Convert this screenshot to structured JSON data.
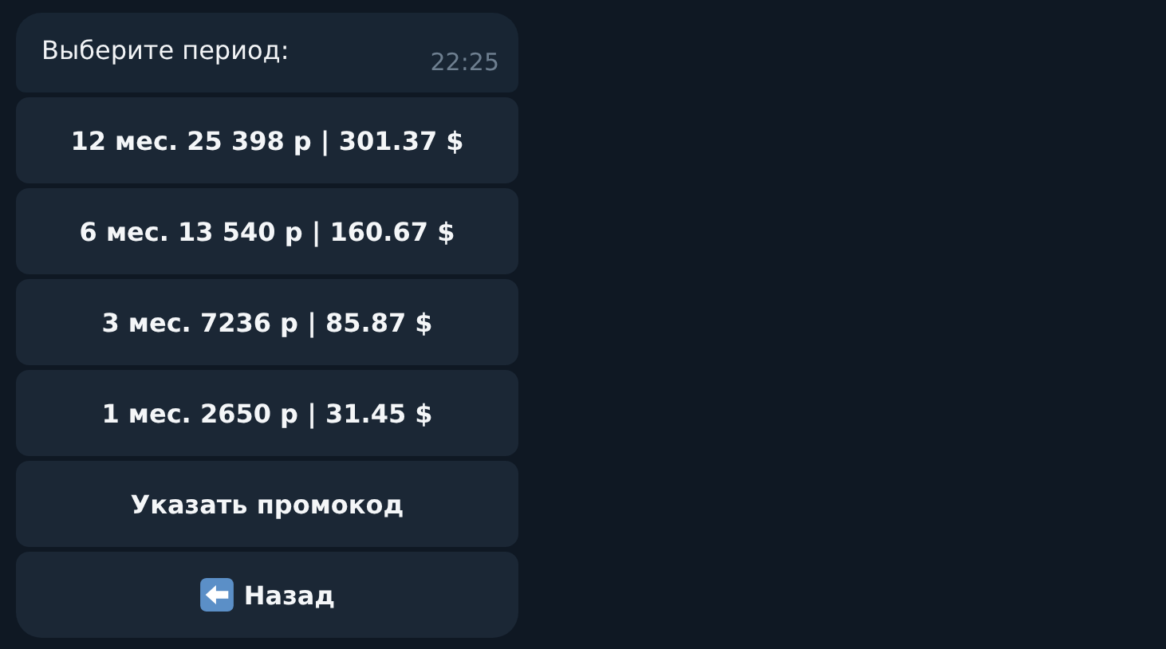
{
  "message": {
    "text": "Выберите период:",
    "time": "22:25"
  },
  "buttons": [
    {
      "kind": "text",
      "label": "12 мес. 25 398 р | 301.37 $"
    },
    {
      "kind": "text",
      "label": "6 мес. 13 540 р | 160.67 $"
    },
    {
      "kind": "text",
      "label": "3 мес. 7236 р | 85.87 $"
    },
    {
      "kind": "text",
      "label": "1 мес. 2650 р | 31.45 $"
    },
    {
      "kind": "text",
      "label": "Указать промокод"
    },
    {
      "kind": "back",
      "label": "Назад"
    }
  ]
}
